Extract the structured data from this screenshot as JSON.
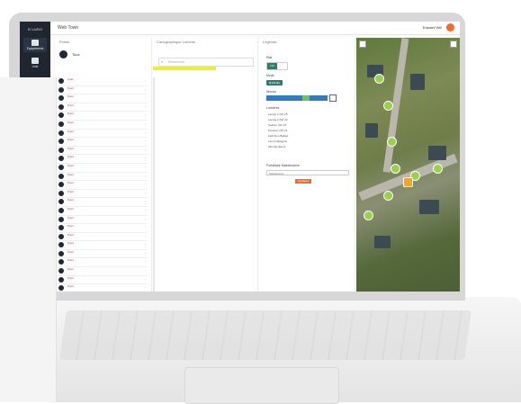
{
  "nav": {
    "logo": "ECLAIRIO",
    "items": [
      {
        "label": "Equipements",
        "icon": "equipment-icon"
      },
      {
        "label": "Liste",
        "icon": "list-icon"
      }
    ]
  },
  "topbar": {
    "title": "Web Town",
    "user": "Edward Will"
  },
  "panel1": {
    "title": "Points",
    "filter_label": "Tous",
    "rows": [
      {
        "name": "Liste"
      },
      {
        "name": "Point"
      },
      {
        "name": "Point"
      },
      {
        "name": "Point"
      },
      {
        "name": "Point"
      },
      {
        "name": "Point"
      },
      {
        "name": "Point"
      },
      {
        "name": "Point"
      },
      {
        "name": "Point"
      },
      {
        "name": "Point"
      },
      {
        "name": "Point"
      },
      {
        "name": "Point"
      },
      {
        "name": "Point"
      },
      {
        "name": "Point"
      },
      {
        "name": "Point"
      },
      {
        "name": "Point"
      },
      {
        "name": "Point"
      },
      {
        "name": "Point"
      },
      {
        "name": "Point"
      },
      {
        "name": "Point"
      },
      {
        "name": "Point"
      },
      {
        "name": "Point"
      },
      {
        "name": "Point"
      },
      {
        "name": "Point"
      },
      {
        "name": "Point"
      },
      {
        "name": "Point"
      },
      {
        "name": "Point"
      },
      {
        "name": "Point"
      },
      {
        "name": "Point"
      },
      {
        "name": "Point"
      }
    ]
  },
  "panel2": {
    "title": "Cartographique Lumens",
    "search_placeholder": "Rechercher"
  },
  "panel3": {
    "title": "Légende",
    "label1": "Etat",
    "toggle_on": "ON",
    "label2": "Mode",
    "pill": "MANUEL",
    "label3": "Niveau",
    "legend_title": "Lumieres",
    "legend": [
      "Lampe 1 (W) 25",
      "Lampe 2 (W) 32",
      "Sodium (W) 15",
      "Pression (W) 21",
      "LED Fluo Ballast",
      "Lamp Halogène",
      "Allumée Eteint"
    ],
    "select_label": "Forfaitaire Maintenance",
    "select_value": "Sélectionner",
    "apply": "Appliquer"
  },
  "colors": {
    "accent": "#f26b2b",
    "nav": "#1f2630",
    "green": "#2f7d68",
    "marker": "#9bd04a"
  }
}
